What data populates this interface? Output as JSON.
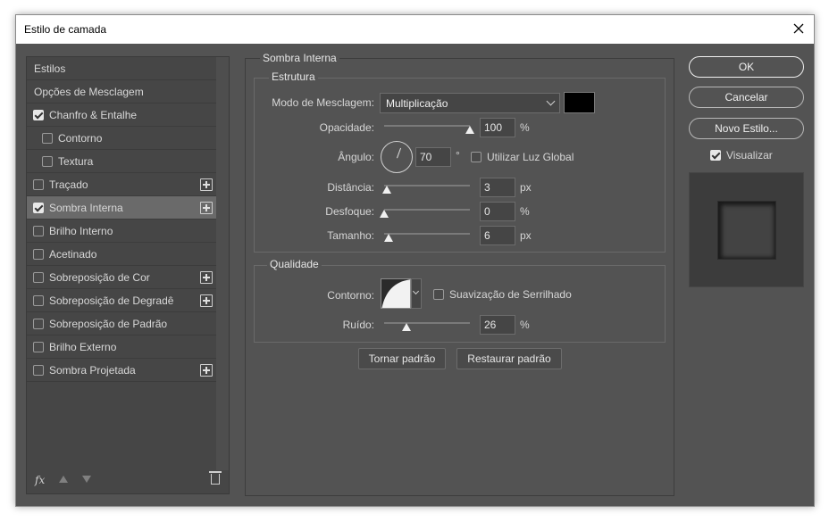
{
  "window": {
    "title": "Estilo de camada"
  },
  "sidebar": {
    "header_styles": "Estilos",
    "header_blend": "Opções de Mesclagem",
    "items": [
      {
        "label": "Chanfro & Entalhe",
        "checked": true,
        "indent": false,
        "plus": false
      },
      {
        "label": "Contorno",
        "checked": false,
        "indent": true,
        "plus": false
      },
      {
        "label": "Textura",
        "checked": false,
        "indent": true,
        "plus": false
      },
      {
        "label": "Traçado",
        "checked": false,
        "indent": false,
        "plus": true
      },
      {
        "label": "Sombra Interna",
        "checked": true,
        "indent": false,
        "plus": true,
        "selected": true
      },
      {
        "label": "Brilho Interno",
        "checked": false,
        "indent": false,
        "plus": false
      },
      {
        "label": "Acetinado",
        "checked": false,
        "indent": false,
        "plus": false
      },
      {
        "label": "Sobreposição de Cor",
        "checked": false,
        "indent": false,
        "plus": true
      },
      {
        "label": "Sobreposição de Degradê",
        "checked": false,
        "indent": false,
        "plus": true
      },
      {
        "label": "Sobreposição de Padrão",
        "checked": false,
        "indent": false,
        "plus": false
      },
      {
        "label": "Brilho Externo",
        "checked": false,
        "indent": false,
        "plus": false
      },
      {
        "label": "Sombra Projetada",
        "checked": false,
        "indent": false,
        "plus": true
      }
    ],
    "footer_fx": "fx"
  },
  "panel": {
    "section_title": "Sombra Interna",
    "structure": {
      "legend": "Estrutura",
      "blend_mode_label": "Modo de Mesclagem:",
      "blend_mode_value": "Multiplicação",
      "shadow_color": "#000000",
      "opacity_label": "Opacidade:",
      "opacity_value": "100",
      "opacity_unit": "%",
      "opacity_level": 1.0,
      "angle_label": "Ângulo:",
      "angle_value": "70",
      "angle_unit": "°",
      "global_light_label": "Utilizar Luz Global",
      "global_light_checked": false,
      "distance_label": "Distância:",
      "distance_value": "3",
      "distance_unit": "px",
      "distance_level": 0.03,
      "choke_label": "Desfoque:",
      "choke_value": "0",
      "choke_unit": "%",
      "choke_level": 0.0,
      "size_label": "Tamanho:",
      "size_value": "6",
      "size_unit": "px",
      "size_level": 0.05
    },
    "quality": {
      "legend": "Qualidade",
      "contour_label": "Contorno:",
      "antialias_label": "Suavização de Serrilhado",
      "antialias_checked": false,
      "noise_label": "Ruído:",
      "noise_value": "26",
      "noise_unit": "%",
      "noise_level": 0.26
    },
    "make_default": "Tornar padrão",
    "reset_default": "Restaurar padrão"
  },
  "actions": {
    "ok": "OK",
    "cancel": "Cancelar",
    "new_style": "Novo Estilo...",
    "preview_label": "Visualizar",
    "preview_checked": true
  }
}
